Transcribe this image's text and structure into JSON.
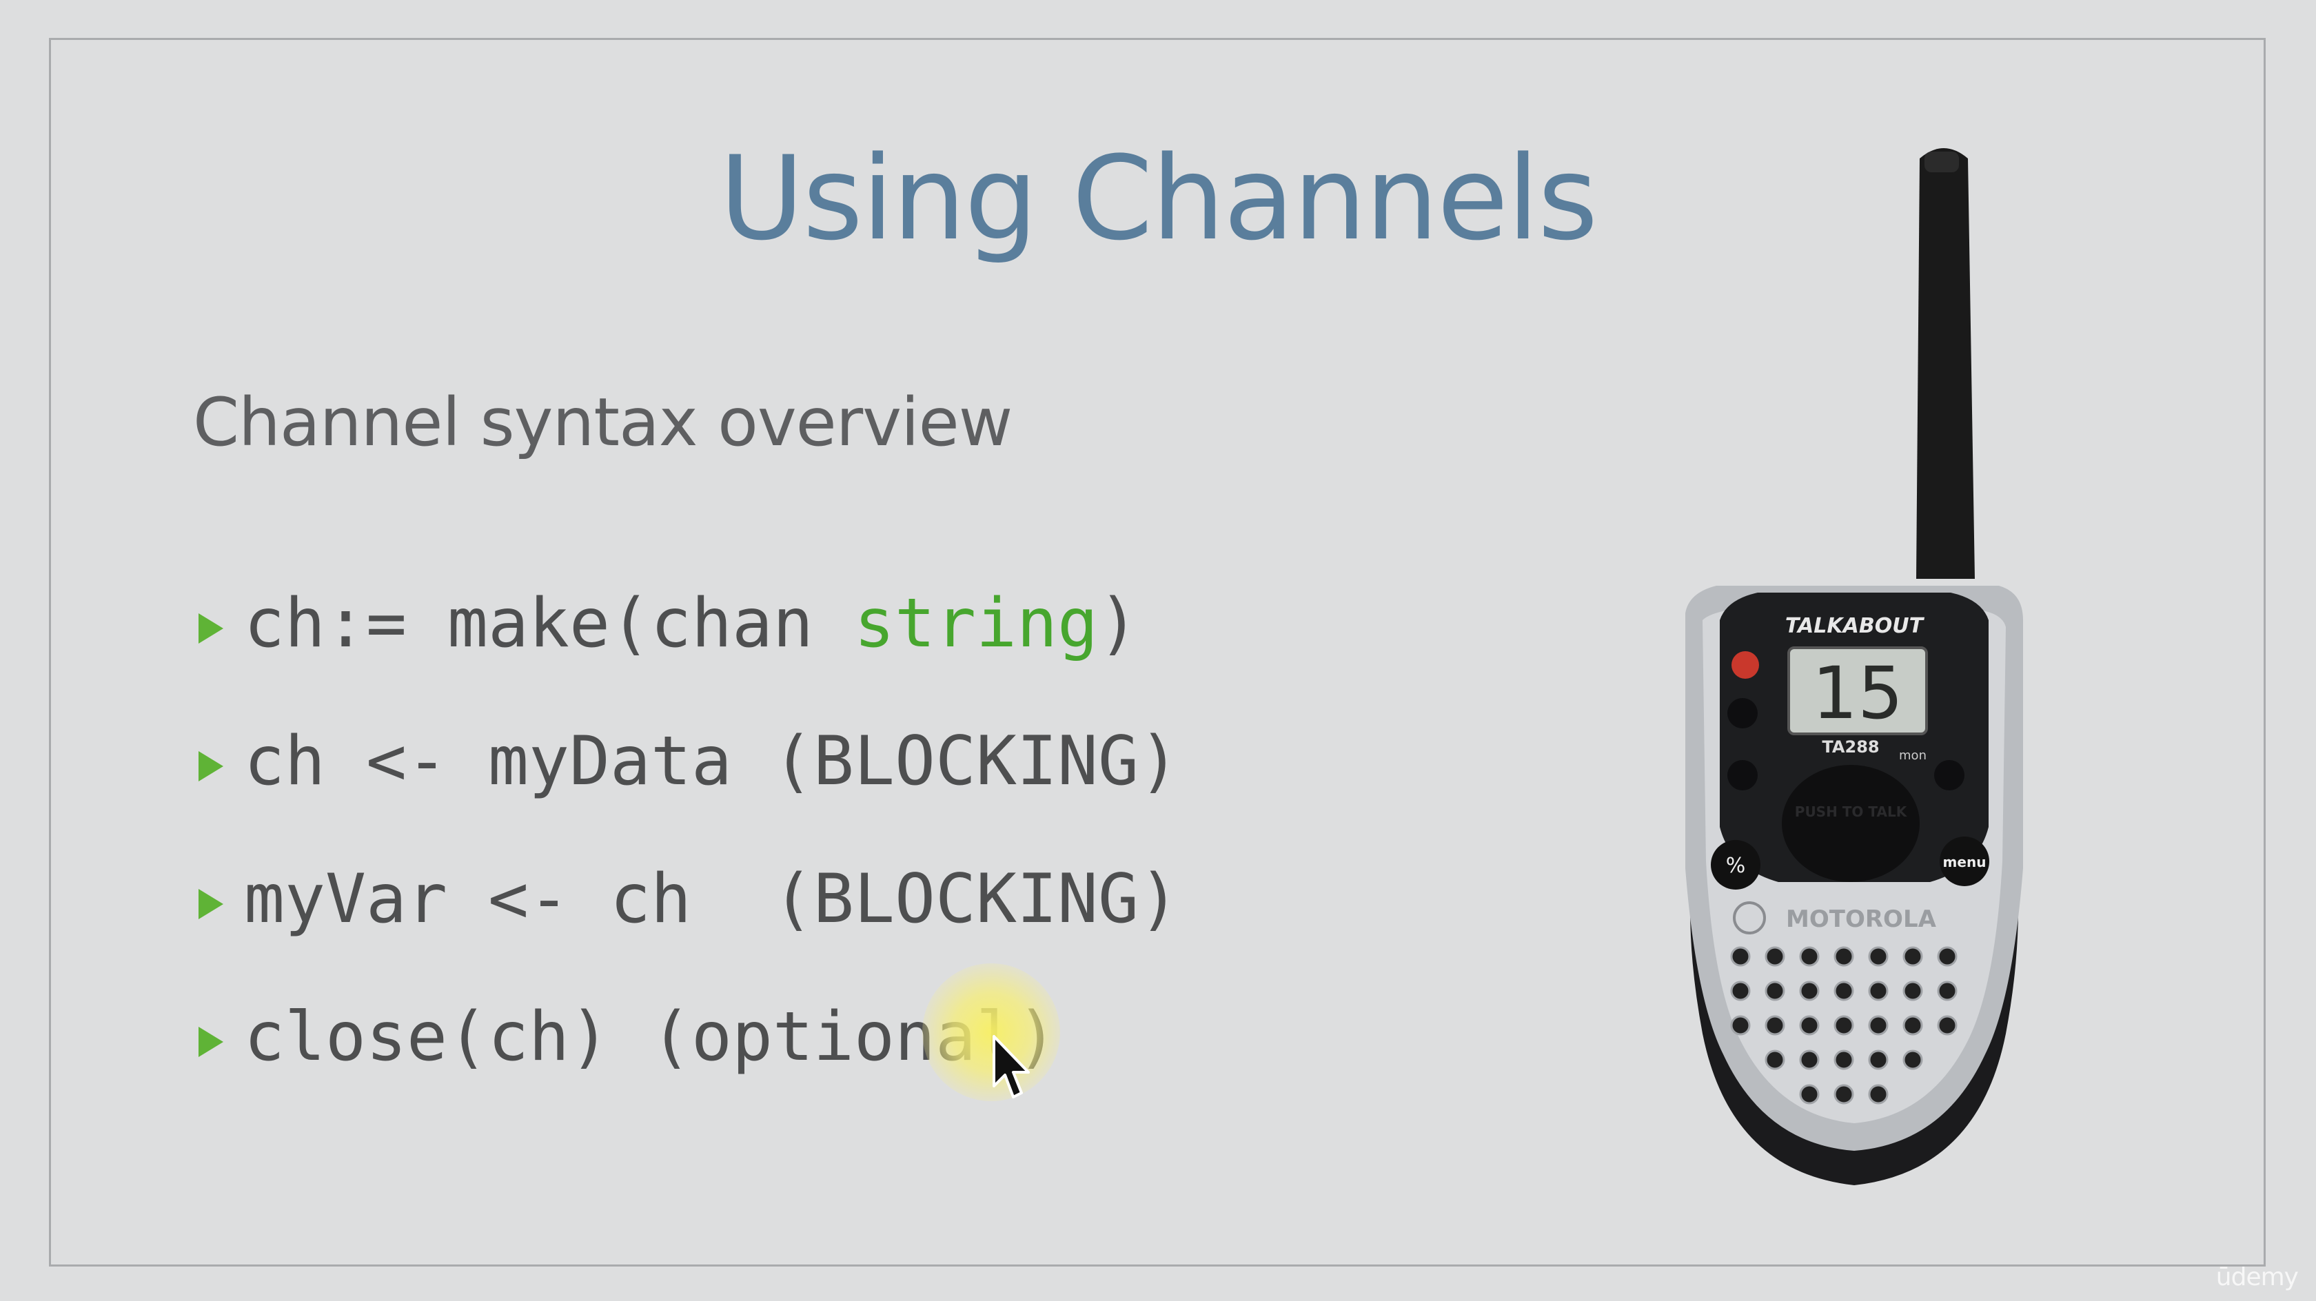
{
  "slide": {
    "title": "Using Channels",
    "subtitle": "Channel syntax overview",
    "bullets": [
      {
        "prefix": "ch:= make(chan ",
        "keyword": "string",
        "suffix": ")"
      },
      {
        "text": "ch <- myData (BLOCKING)"
      },
      {
        "text": "myVar <- ch  (BLOCKING)"
      },
      {
        "text": "close(ch) (optional)"
      }
    ]
  },
  "device": {
    "brand_top": "TALKABOUT",
    "display_value": "15",
    "model": "TA288",
    "mon_label": "mon",
    "menu_label": "menu",
    "percent_label": "%",
    "brand_bottom": "MOTOROLA",
    "ptt_label": "PUSH TO TALK"
  },
  "watermark": "ūdemy",
  "colors": {
    "title": "#5a7e9c",
    "bullet_marker": "#5fb336",
    "keyword": "#47a62e",
    "background": "#dddedf"
  }
}
